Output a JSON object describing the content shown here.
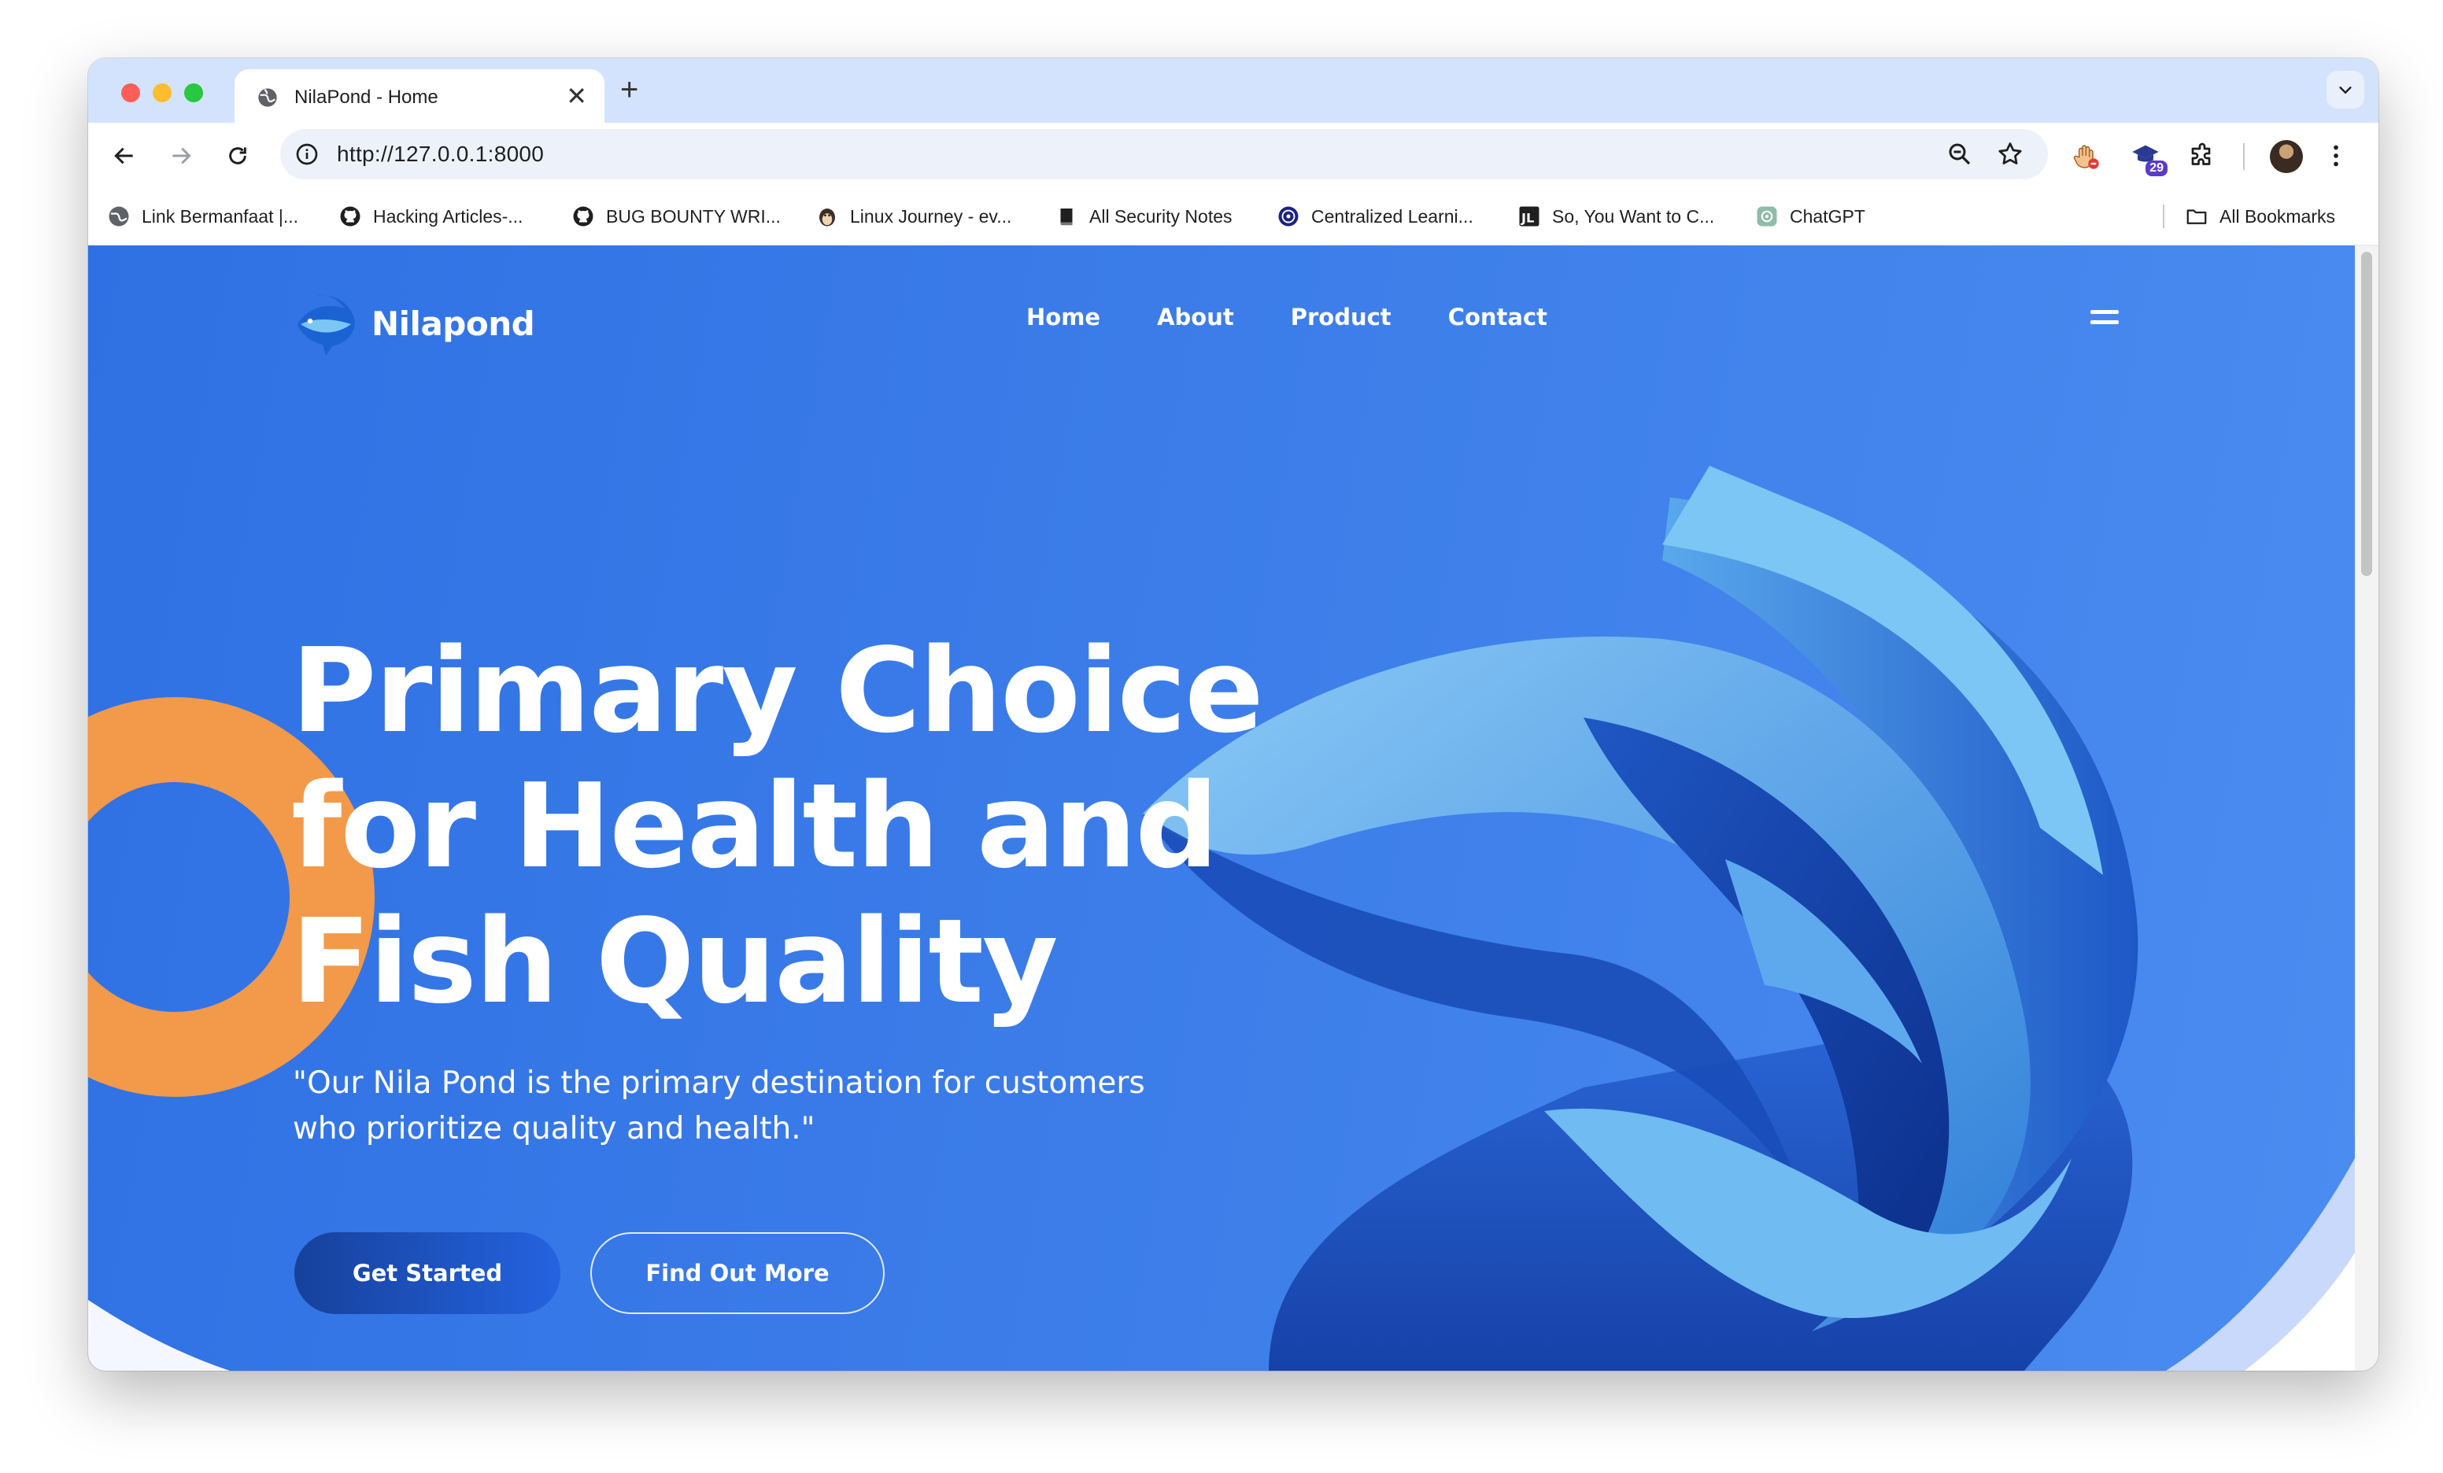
{
  "browser": {
    "tab_title": "NilaPond - Home",
    "url": "http://127.0.0.1:8000",
    "new_tab_symbol": "+",
    "close_symbol": "✕",
    "extension_badge": "29",
    "bookmarks": [
      {
        "label": "Link Bermanfaat |...",
        "icon": "globe-icon"
      },
      {
        "label": "Hacking Articles-...",
        "icon": "github-icon"
      },
      {
        "label": "BUG BOUNTY WRI...",
        "icon": "github-icon"
      },
      {
        "label": "Linux Journey - ev...",
        "icon": "penguin-icon"
      },
      {
        "label": "All Security Notes",
        "icon": "book-icon"
      },
      {
        "label": "Centralized Learni...",
        "icon": "shield-icon"
      },
      {
        "label": "So, You Want to C...",
        "icon": "jl-icon"
      },
      {
        "label": "ChatGPT",
        "icon": "chatgpt-icon"
      }
    ],
    "all_bookmarks": "All Bookmarks"
  },
  "site": {
    "logo_text": "Nilapond",
    "nav": [
      "Home",
      "About",
      "Product",
      "Contact"
    ],
    "hero": {
      "title_lines": [
        "Primary Choice",
        "for Health and",
        "Fish Quality"
      ],
      "subtitle_lines": [
        "\"Our Nila Pond is the primary destination for customers",
        "who prioritize quality and health.\""
      ],
      "primary_button": "Get Started",
      "secondary_button": "Find Out More"
    },
    "colors": {
      "background": "#3a7be8",
      "accent_orange": "#f2994a",
      "button_dark": "#16419c"
    }
  }
}
